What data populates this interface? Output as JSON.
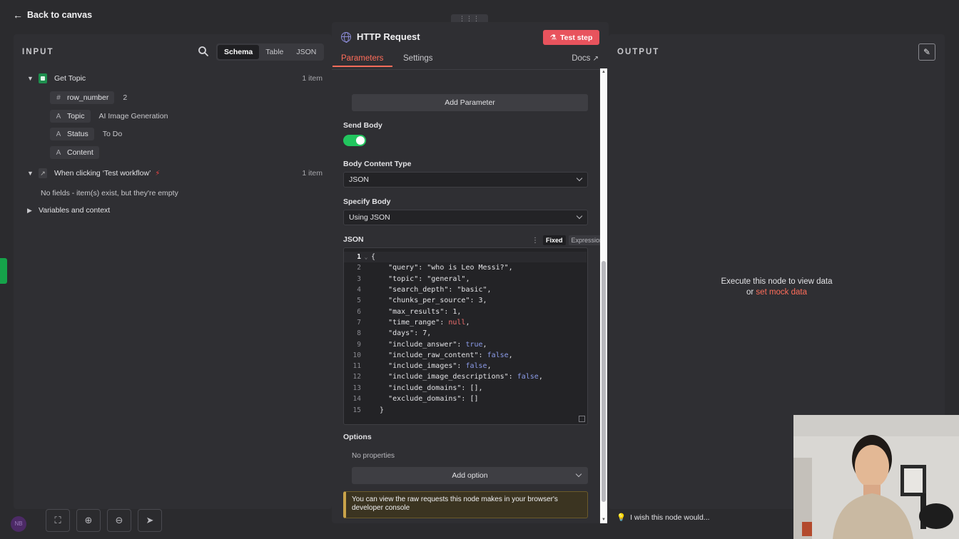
{
  "topbar": {
    "back_label": "Back to canvas"
  },
  "input_panel": {
    "header": "INPUT",
    "view_tabs": [
      "Schema",
      "Table",
      "JSON"
    ],
    "nodes": [
      {
        "name": "Get Topic",
        "count": "1 item",
        "fields": [
          {
            "type": "#",
            "key": "row_number",
            "value": "2"
          },
          {
            "type": "A",
            "key": "Topic",
            "value": "AI Image Generation"
          },
          {
            "type": "A",
            "key": "Status",
            "value": "To Do"
          },
          {
            "type": "A",
            "key": "Content",
            "value": ""
          }
        ]
      },
      {
        "name": "When clicking ‘Test workflow’",
        "count": "1 item",
        "empty_message": "No fields - item(s) exist, but they're empty"
      }
    ],
    "variables_label": "Variables and context"
  },
  "modal": {
    "title": "HTTP Request",
    "test_step_label": "Test step",
    "tabs": [
      "Parameters",
      "Settings"
    ],
    "docs_label": "Docs",
    "add_parameter_label": "Add Parameter",
    "send_body_label": "Send Body",
    "send_body_on": true,
    "body_content_type_label": "Body Content Type",
    "body_content_type_value": "JSON",
    "specify_body_label": "Specify Body",
    "specify_body_value": "Using JSON",
    "json_label": "JSON",
    "mode_options": [
      "Fixed",
      "Expression"
    ],
    "code_lines": [
      "{",
      "    \"query\": \"who is Leo Messi?\",",
      "    \"topic\": \"general\",",
      "    \"search_depth\": \"basic\",",
      "    \"chunks_per_source\": 3,",
      "    \"max_results\": 1,",
      "    \"time_range\": null,",
      "    \"days\": 7,",
      "    \"include_answer\": true,",
      "    \"include_raw_content\": false,",
      "    \"include_images\": false,",
      "    \"include_image_descriptions\": false,",
      "    \"include_domains\": [],",
      "    \"exclude_domains\": []",
      "  }"
    ],
    "options_label": "Options",
    "no_properties_label": "No properties",
    "add_option_label": "Add option",
    "notice_text": "You can view the raw requests this node makes in your browser's developer console"
  },
  "output_panel": {
    "header": "OUTPUT",
    "message_line1": "Execute this node to view data",
    "message_or": "or",
    "mock_link": "set mock data"
  },
  "feedback": {
    "wish_label": "I wish this node would..."
  },
  "avatar_initials": "NB",
  "icons": [
    "arrow-left-icon",
    "search-icon",
    "globe-icon",
    "flask-icon",
    "external-link-icon",
    "pencil-icon",
    "lightbulb-icon",
    "fit-view-icon",
    "zoom-in-icon",
    "zoom-out-icon",
    "tidy-up-icon"
  ],
  "colors": {
    "accent": "#ff6d5a",
    "toggle_on": "#22c55e",
    "test_step": "#e8535d",
    "notice_border": "#c9a34a"
  }
}
